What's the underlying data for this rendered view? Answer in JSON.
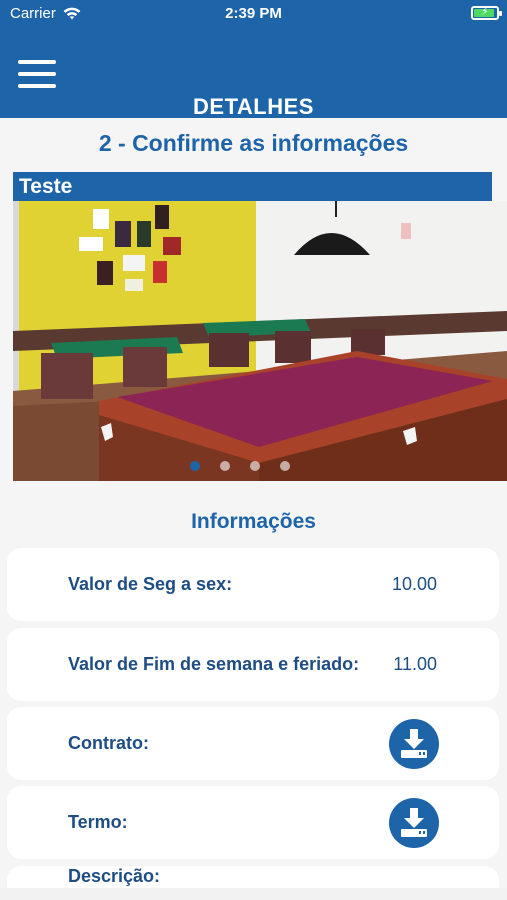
{
  "status_bar": {
    "carrier": "Carrier",
    "time": "2:39 PM"
  },
  "nav": {
    "title": "DETALHES"
  },
  "step": {
    "title": "2 - Confirme as informações"
  },
  "space": {
    "name": "Teste"
  },
  "carousel": {
    "slides": 4,
    "active_index": 0
  },
  "info": {
    "title": "Informações",
    "weekday_label": "Valor de Seg a sex:",
    "weekday_value": "10.00",
    "weekend_label": "Valor de Fim de semana e feriado:",
    "weekend_value": "11.00",
    "contract_label": "Contrato:",
    "term_label": "Termo:",
    "description_label": "Descrição:"
  },
  "colors": {
    "primary": "#1e64a8",
    "text": "#1e4d84",
    "background": "#f5f5f5"
  },
  "icons": {
    "menu": "hamburger-icon",
    "download": "download-icon",
    "wifi": "wifi-icon",
    "battery": "battery-icon"
  }
}
